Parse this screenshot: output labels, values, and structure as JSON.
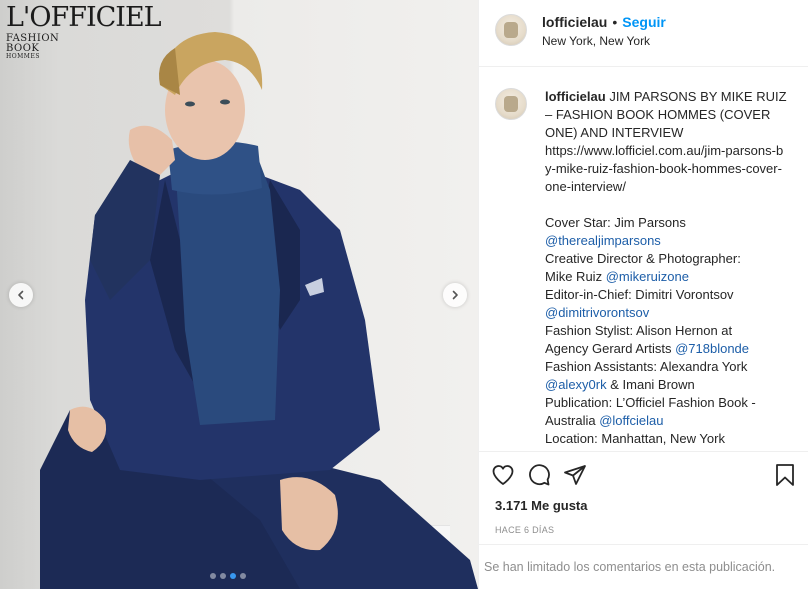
{
  "media": {
    "magazine_logo": {
      "line1": "L'OFFICIEL",
      "line2": "FASHION",
      "line3": "BOOK",
      "line4": "HOMMES"
    },
    "prev_icon": "chevron-left-icon",
    "next_icon": "chevron-right-icon",
    "carousel": {
      "total": 4,
      "active_index": 2
    }
  },
  "header": {
    "username": "lofficielau",
    "separator": "•",
    "follow_label": "Seguir",
    "location": "New York, New York"
  },
  "caption": {
    "username": "lofficielau",
    "title_text": "JIM PARSONS BY MIKE RUIZ – FASHION BOOK HOMMES (COVER ONE) AND INTERVIEW",
    "url": "https://www.lofficiel.com.au/jim-parsons-by-mike-ruiz-fashion-book-hommes-cover-one-interview/",
    "cover_star": "Cover Star: Jim Parsons",
    "cover_star_mention": "@therealjimparsons",
    "director_label": "Creative Director & Photographer:",
    "director_name": "Mike Ruiz",
    "director_mention": "@mikeruizone",
    "editor": "Editor-in-Chief: Dimitri Vorontsov",
    "editor_mention": "@dimitrivorontsov",
    "stylist": "Fashion Stylist: Alison Hernon at",
    "stylist_agency": "Agency Gerard Artists",
    "stylist_mention": "@718blonde",
    "assistants": "Fashion Assistants: Alexandra York",
    "assistant_mention": "@alexy0rk",
    "assistant_other": "& Imani Brown",
    "publication": "Publication: L’Officiel Fashion Book -",
    "publication_cont": "Australia",
    "publication_mention": "@loffcielau",
    "location": "Location: Manhattan, New York"
  },
  "actions": {
    "like_icon": "heart-icon",
    "comment_icon": "comment-icon",
    "share_icon": "share-icon",
    "save_icon": "bookmark-icon",
    "likes": "3.171 Me gusta",
    "time": "HACE 6 DÍAS"
  },
  "footer": {
    "limited_text": "Se han limitado los comentarios en esta publicación."
  }
}
